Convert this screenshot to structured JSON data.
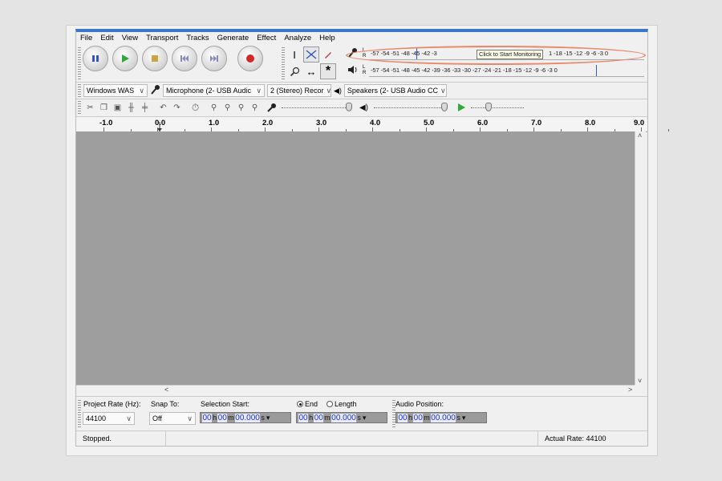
{
  "menu": [
    "File",
    "Edit",
    "View",
    "Transport",
    "Tracks",
    "Generate",
    "Effect",
    "Analyze",
    "Help"
  ],
  "meters": {
    "record_scale": "-57 -54 -51 -48 -45 -42 -3",
    "record_scale_tail": "1 -18 -15 -12 -9 -6 -3 0",
    "playback_scale": "-57 -54 -51 -48 -45 -42 -39 -36 -33 -30 -27 -24 -21 -18 -15 -12 -9 -6 -3 0",
    "monitor_tooltip": "Click to Start Monitoring",
    "lr_left": "L",
    "lr_right": "R"
  },
  "devices": {
    "host": "Windows WAS",
    "recording_device": "Microphone (2- USB Audic",
    "channels": "2 (Stereo) Recor",
    "playback_device": "Speakers (2- USB Audio CC"
  },
  "ruler": {
    "labels": [
      "-1.0",
      "0.0",
      "1.0",
      "2.0",
      "3.0",
      "4.0",
      "5.0",
      "6.0",
      "7.0",
      "8.0",
      "9.0"
    ]
  },
  "selection": {
    "project_rate_label": "Project Rate (Hz):",
    "project_rate_value": "44100",
    "snap_to_label": "Snap To:",
    "snap_to_value": "Off",
    "selection_start_label": "Selection Start:",
    "end_label": "End",
    "length_label": "Length",
    "audio_position_label": "Audio Position:",
    "time_hours": "00",
    "time_minutes": "00",
    "time_seconds": "00.000",
    "unit_h": "h",
    "unit_m": "m",
    "unit_s": "s"
  },
  "status": {
    "state": "Stopped.",
    "actual_rate": "Actual Rate: 44100"
  },
  "colors": {
    "title_accent": "#3c78c9",
    "highlight_oval": "#e8896a",
    "pause": "#3355cc",
    "play": "#2eaa3a",
    "stop": "#c9a640",
    "record": "#d02828",
    "track_area": "#9e9e9e"
  }
}
